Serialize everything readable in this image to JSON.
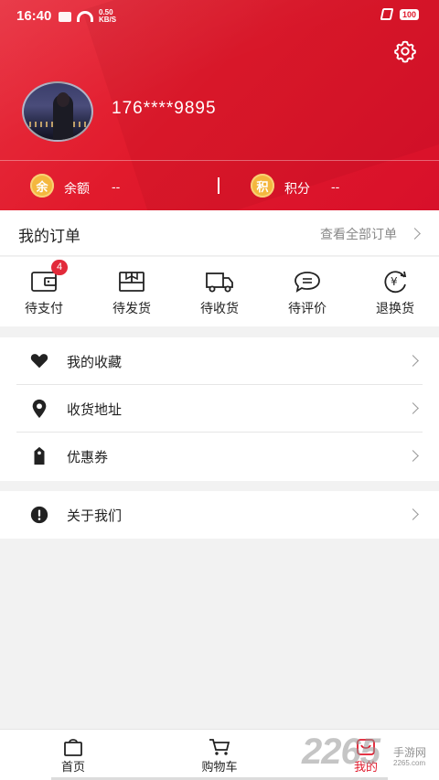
{
  "status_bar": {
    "time": "16:40",
    "speed_top": "0.50",
    "speed_bottom": "KB/S",
    "battery": "100"
  },
  "profile": {
    "phone": "176****9895"
  },
  "wallet": {
    "balance_icon_char": "余",
    "balance_label": "余额",
    "balance_value": "--",
    "points_icon_char": "积",
    "points_label": "积分",
    "points_value": "--"
  },
  "orders": {
    "title": "我的订单",
    "view_all": "查看全部订单",
    "items": [
      {
        "label": "待支付",
        "icon": "wallet-icon",
        "badge": "4"
      },
      {
        "label": "待发货",
        "icon": "package-icon"
      },
      {
        "label": "待收货",
        "icon": "truck-icon"
      },
      {
        "label": "待评价",
        "icon": "comment-icon"
      },
      {
        "label": "退换货",
        "icon": "refund-icon"
      }
    ]
  },
  "menu": {
    "favorites": "我的收藏",
    "address": "收货地址",
    "coupons": "优惠券",
    "about": "关于我们"
  },
  "tabbar": {
    "items": [
      {
        "label": "首页",
        "icon": "shopping-bag-icon"
      },
      {
        "label": "购物车",
        "icon": "cart-icon"
      },
      {
        "label": "我的",
        "icon": "user-icon",
        "active": true
      }
    ]
  },
  "watermark": {
    "number": "2265",
    "cn": "手游网",
    "domain": "2265.com"
  },
  "colors": {
    "brand_red": "#e11a2c",
    "coin_gold": "#f4b73e",
    "badge_red": "#e22a3a"
  }
}
